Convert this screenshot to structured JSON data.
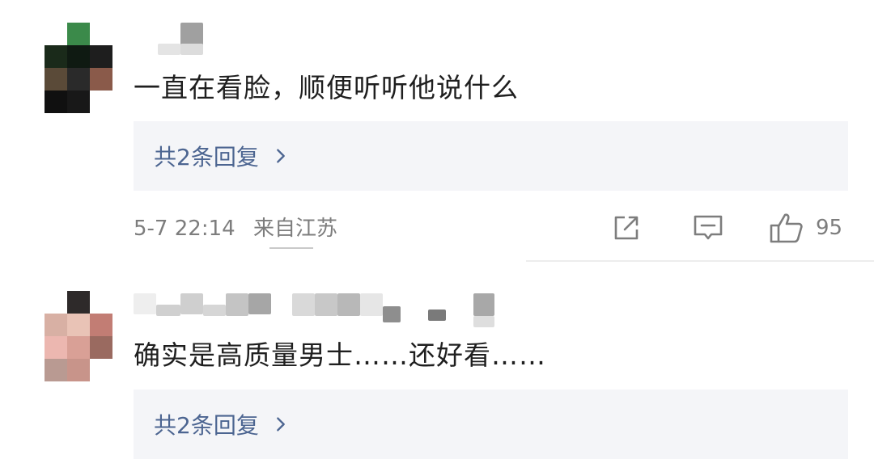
{
  "comments": [
    {
      "text": "一直在看脸，顺便听听他说什么",
      "replies_label": "共2条回复",
      "time": "5-7 22:14",
      "location": "来自江苏",
      "likes": "95"
    },
    {
      "text": "确实是高质量男士……还好看……",
      "replies_label": "共2条回复"
    }
  ],
  "icons": {
    "share": "share-icon",
    "comment": "comment-icon",
    "like": "thumbs-up-icon",
    "chevron": "chevron-right-icon"
  },
  "colors": {
    "reply_link": "#4c6591",
    "reply_bg": "#f4f5f8",
    "meta_gray": "#7d7d7d",
    "text": "#1f1f1f"
  }
}
